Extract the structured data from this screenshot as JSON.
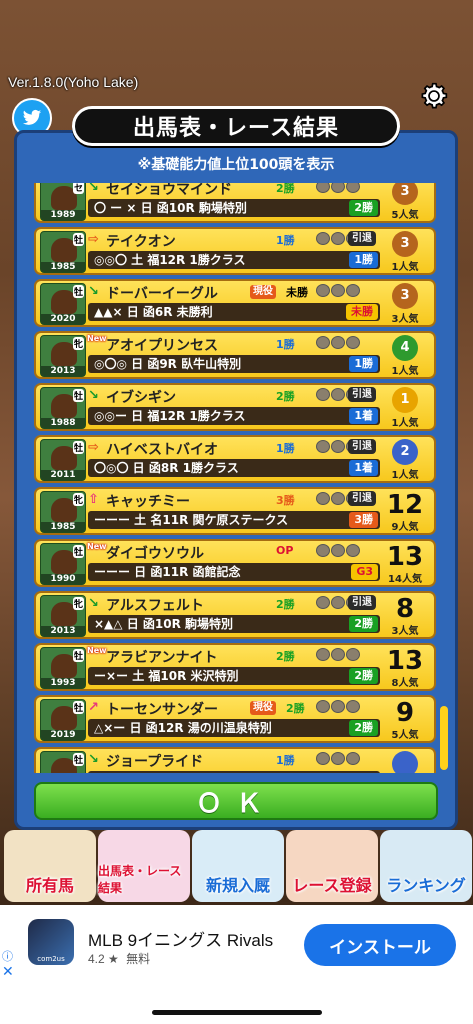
{
  "version": "Ver.1.8.0(Yoho Lake)",
  "title": "出馬表・レース結果",
  "subtitle": "※基礎能力値上位100頭を表示",
  "ok_label": "ＯＫ",
  "colors": {
    "panel": "#2f67b8",
    "row": "#f7c81d",
    "ok": "#3aae21",
    "install": "#1a73e8"
  },
  "horses": [
    {
      "year": "1989",
      "sex": "セ",
      "arrow": "↘",
      "new": "",
      "name": "セイショウマインド",
      "badge": "",
      "wins": "2勝",
      "wins_color": "g",
      "retired": "",
      "marks": "〇 ー × 日",
      "race": "函10R 駒場特別",
      "result": "2勝",
      "result_color": "g",
      "rank": "3",
      "medal": "bronze",
      "popularity": "5人気"
    },
    {
      "year": "1985",
      "sex": "牡",
      "arrow": "⇨",
      "new": "",
      "name": "テイクオン",
      "badge": "",
      "wins": "1勝",
      "wins_color": "b",
      "retired": "引退",
      "marks": "◎◎〇 土",
      "race": "福12R 1勝クラス",
      "result": "1勝",
      "result_color": "b",
      "rank": "3",
      "medal": "bronze",
      "popularity": "1人気"
    },
    {
      "year": "2020",
      "sex": "牡",
      "arrow": "↘",
      "new": "",
      "name": "ドーバーイーグル",
      "badge": "現役",
      "wins": "未勝",
      "wins_color": "k",
      "retired": "",
      "marks": "▲▲× 日",
      "race": "函6R 未勝利",
      "result": "未勝",
      "result_color": "y",
      "rank": "3",
      "medal": "bronze",
      "popularity": "3人気"
    },
    {
      "year": "2013",
      "sex": "牝",
      "arrow": "",
      "new": "New",
      "name": "アオイプリンセス",
      "badge": "",
      "wins": "1勝",
      "wins_color": "b",
      "retired": "",
      "marks": "◎〇◎ 日",
      "race": "函9R 臥牛山特別",
      "result": "1勝",
      "result_color": "b",
      "rank": "4",
      "medal": "laurel",
      "popularity": "1人気"
    },
    {
      "year": "1988",
      "sex": "牡",
      "arrow": "↘",
      "new": "",
      "name": "イブシギン",
      "badge": "",
      "wins": "2勝",
      "wins_color": "g",
      "retired": "引退",
      "marks": "◎◎ー 日",
      "race": "福12R 1勝クラス",
      "result": "1着",
      "result_color": "b",
      "rank": "1",
      "medal": "gold",
      "popularity": "1人気"
    },
    {
      "year": "2011",
      "sex": "牡",
      "arrow": "⇨",
      "new": "",
      "name": "ハイベストバイオ",
      "badge": "",
      "wins": "1勝",
      "wins_color": "b",
      "retired": "引退",
      "marks": "〇◎〇 日",
      "race": "函8R 1勝クラス",
      "result": "1着",
      "result_color": "b",
      "rank": "2",
      "medal": "silver",
      "popularity": "1人気"
    },
    {
      "year": "1985",
      "sex": "牝",
      "arrow": "⇧",
      "new": "",
      "name": "キャッチミー",
      "badge": "",
      "wins": "3勝",
      "wins_color": "o",
      "retired": "引退",
      "marks": "ーーー 土",
      "race": "名11R 関ケ原ステークス",
      "result": "3勝",
      "result_color": "o",
      "rank": "12",
      "medal": "",
      "popularity": "9人気"
    },
    {
      "year": "1990",
      "sex": "牡",
      "arrow": "",
      "new": "New",
      "name": "ダイゴウソウル",
      "badge": "",
      "wins": "OP",
      "wins_color": "r",
      "retired": "",
      "marks": "ーーー 日",
      "race": "函11R 函館記念",
      "result": "G3",
      "result_color": "y",
      "rank": "13",
      "medal": "",
      "popularity": "14人気"
    },
    {
      "year": "2013",
      "sex": "牝",
      "arrow": "↘",
      "new": "",
      "name": "アルスフェルト",
      "badge": "",
      "wins": "2勝",
      "wins_color": "g",
      "retired": "引退",
      "marks": "×▲△ 日",
      "race": "函10R 駒場特別",
      "result": "2勝",
      "result_color": "g",
      "rank": "8",
      "medal": "",
      "popularity": "3人気"
    },
    {
      "year": "1993",
      "sex": "牡",
      "arrow": "",
      "new": "New",
      "name": "アラビアンナイト",
      "badge": "",
      "wins": "2勝",
      "wins_color": "g",
      "retired": "",
      "marks": "ー×ー 土",
      "race": "福10R 米沢特別",
      "result": "2勝",
      "result_color": "g",
      "rank": "13",
      "medal": "",
      "popularity": "8人気"
    },
    {
      "year": "2019",
      "sex": "牡",
      "arrow": "↗",
      "new": "",
      "name": "トーセンサンダー",
      "badge": "現役",
      "wins": "2勝",
      "wins_color": "g",
      "retired": "",
      "marks": "△×ー 日",
      "race": "函12R 湯の川温泉特別",
      "result": "2勝",
      "result_color": "g",
      "rank": "9",
      "medal": "",
      "popularity": "5人気"
    },
    {
      "year": "",
      "sex": "牡",
      "arrow": "↘",
      "new": "",
      "name": "ジョープライド",
      "badge": "",
      "wins": "1勝",
      "wins_color": "b",
      "retired": "",
      "marks": "",
      "race": "",
      "result": "",
      "result_color": "b",
      "rank": "",
      "medal": "silver",
      "popularity": ""
    }
  ],
  "nav": [
    {
      "label": "所有馬",
      "color": "#d13"
    },
    {
      "label": "出馬表・レース結果",
      "color": "#d13"
    },
    {
      "label": "新規入厩",
      "color": "#1a6cd6"
    },
    {
      "label": "レース登録",
      "color": "#d13"
    },
    {
      "label": "ランキング",
      "color": "#1a6cd6"
    }
  ],
  "ad": {
    "app_name": "MLB 9イニングス Rivals",
    "rating": "4.2",
    "star": "★",
    "price": "無料",
    "install": "インストール",
    "icon_text": "com2us"
  }
}
